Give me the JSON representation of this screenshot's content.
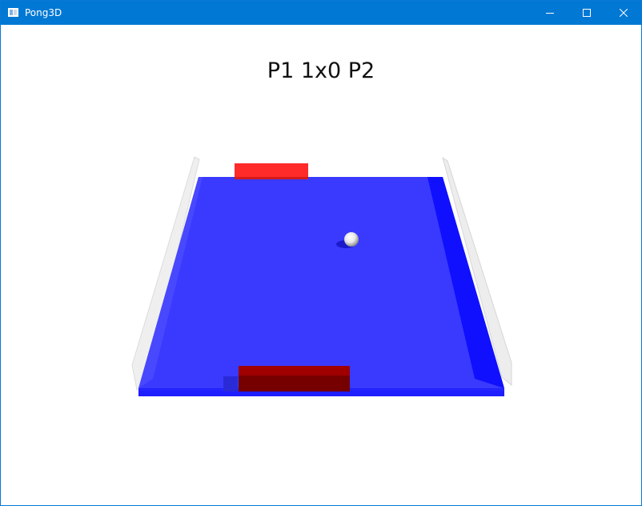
{
  "window": {
    "title": "Pong3D",
    "accent_color": "#0078d4",
    "controls": {
      "minimize_icon": "minimize-icon",
      "maximize_icon": "maximize-icon",
      "close_icon": "close-icon"
    }
  },
  "game": {
    "scoreboard": "P1 1x0 P2",
    "colors": {
      "field": "#3a3aff",
      "field_border": "#1010ff",
      "paddle_p1": "#8b0000",
      "paddle_p2": "#ff2a2a",
      "ball": "#ffffff",
      "side_walls": "#e6e6e6"
    }
  }
}
